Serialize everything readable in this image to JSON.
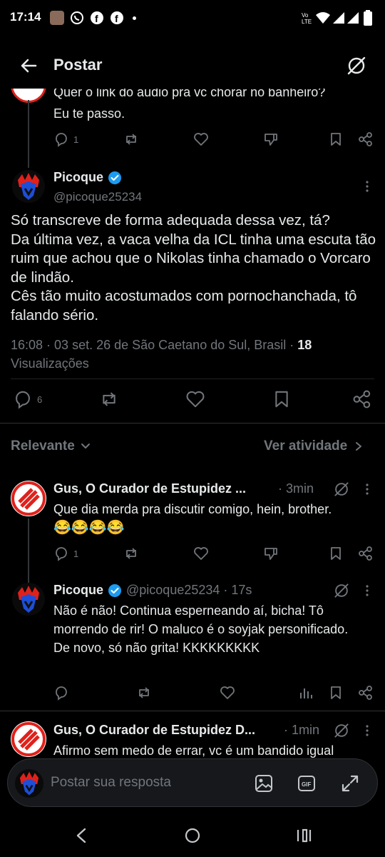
{
  "status_bar": {
    "time": "17:14"
  },
  "header": {
    "title": "Postar"
  },
  "prev_tweet": {
    "text_cut": "Quer o link do áudio pra vc chorar no banheiro?",
    "text": "Eu te passo.",
    "replies": "1"
  },
  "main_tweet": {
    "name": "Picoque",
    "handle": "@picoque25234",
    "text": "Só transcreve de forma adequada dessa vez, tá?\nDa última vez, a vaca velha da ICL tinha uma escuta tão ruim que achou que o Nikolas tinha chamado o Vorcaro de lindão.\nCês tão muito acostumados com pornochanchada, tô falando sério.",
    "meta": "16:08 · 03 set. 26 de São Caetano do Sul, Brasil · ",
    "views_count": "18",
    "views_label": "Visualizações",
    "replies": "6"
  },
  "sort": {
    "label": "Relevante",
    "activity": "Ver atividade"
  },
  "replies": [
    {
      "name": "Gus, O Curador de Estupidez ...",
      "time": "· 3min",
      "text": "Que dia merda pra discutir comigo, hein, brother.",
      "emoji": "😂😂😂😂",
      "replies": "1"
    },
    {
      "name": "Picoque",
      "handle": "@picoque25234 · 17s",
      "text": "Não é não! Continua esperneando aí, bicha! Tô morrendo de rir! O maluco é o soyjak personificado.\nDe novo, só não grita! KKKKKKKKK"
    },
    {
      "name": "Gus, O Curador de Estupidez D...",
      "time": "· 1min",
      "text": "Afirmo sem medo de errar, vc é um bandido igual"
    }
  ],
  "composer": {
    "placeholder": "Postar sua resposta"
  },
  "colors": {
    "verified": "#1d9bf0",
    "muted": "#71767b",
    "background": "#000000",
    "accent_red": "#e0211b"
  }
}
